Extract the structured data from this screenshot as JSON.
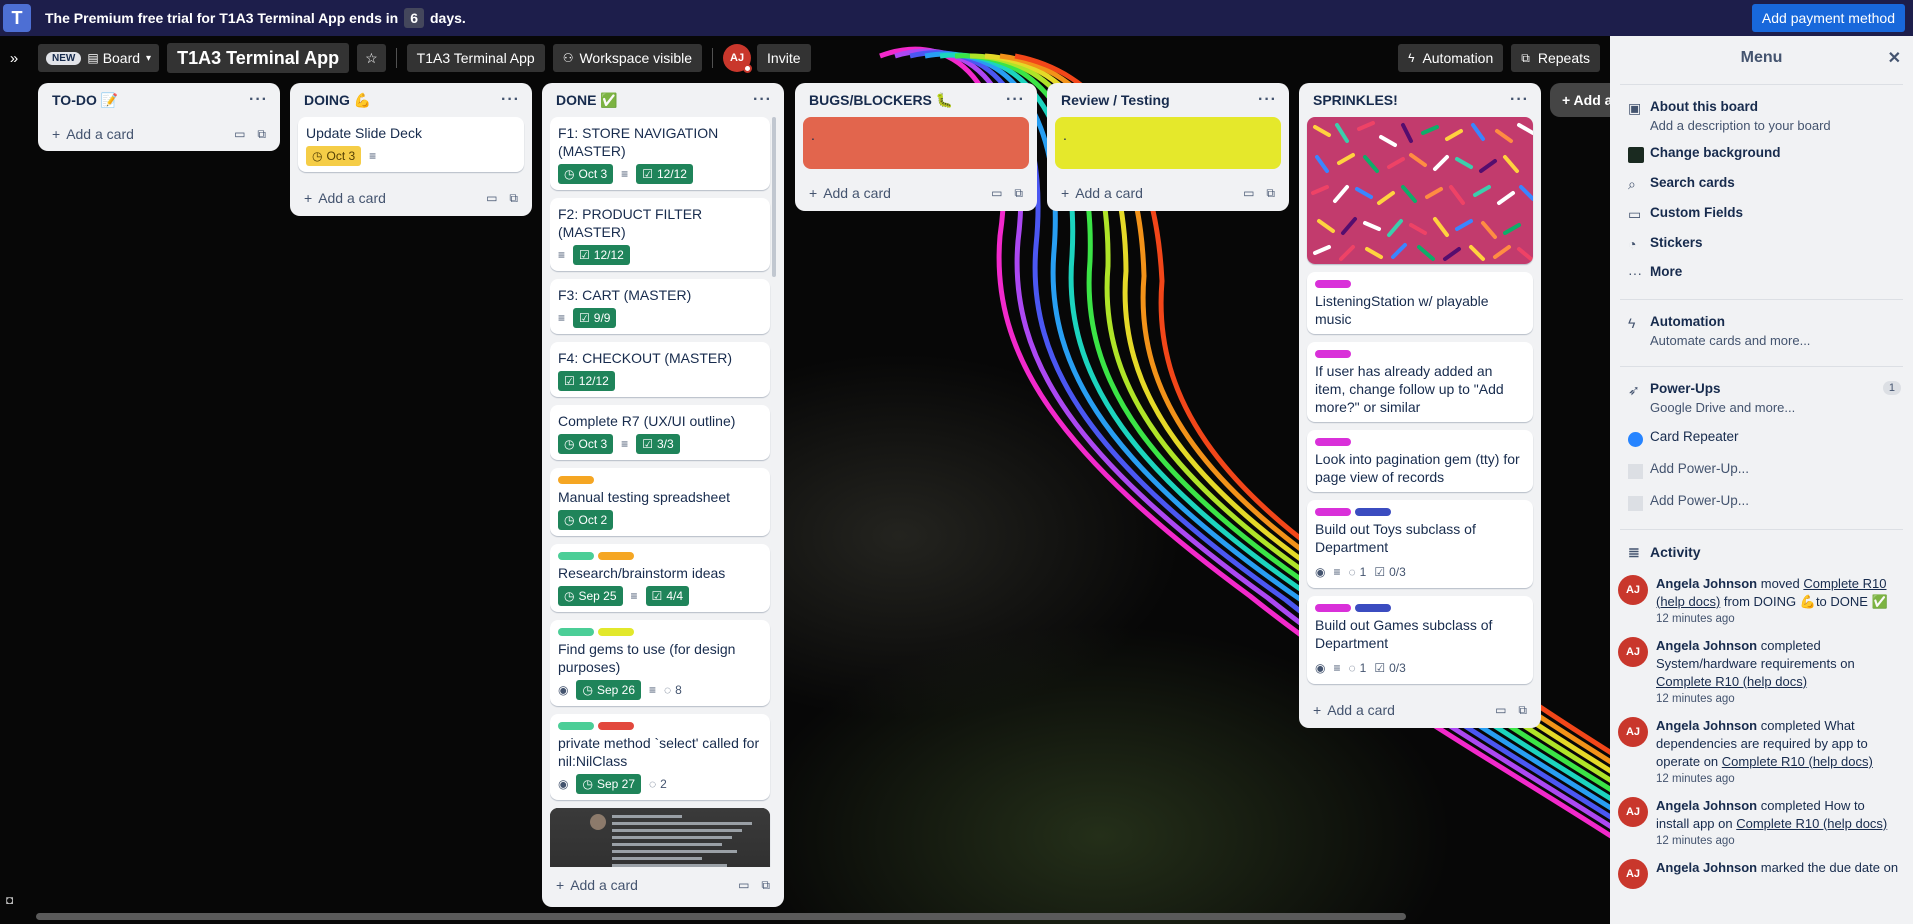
{
  "trial": {
    "text_before": "The Premium free trial for T1A3 Terminal App ends in",
    "days": "6",
    "text_after": "days.",
    "pay_button": "Add payment method"
  },
  "header": {
    "new_badge": "NEW",
    "board_view": "Board",
    "board_title": "T1A3 Terminal App",
    "workspace_name": "T1A3 Terminal App",
    "visibility": "Workspace visible",
    "avatar_initials": "AJ",
    "invite": "Invite",
    "automation": "Automation",
    "repeats": "Repeats"
  },
  "lists": {
    "todo": {
      "title": "TO-DO 📝",
      "add": "Add a card"
    },
    "doing": {
      "title": "DOING 💪",
      "add": "Add a card",
      "cards": [
        {
          "title": "Update Slide Deck",
          "due": "Oct 3"
        }
      ]
    },
    "done": {
      "title": "DONE ✅",
      "add": "Add a card",
      "cards": [
        {
          "title": "F1: STORE NAVIGATION (MASTER)",
          "due": "Oct 3",
          "check": "12/12"
        },
        {
          "title": "F2: PRODUCT FILTER (MASTER)",
          "check": "12/12"
        },
        {
          "title": "F3: CART (MASTER)",
          "check": "9/9"
        },
        {
          "title": "F4: CHECKOUT (MASTER)",
          "check": "12/12"
        },
        {
          "title": "Complete R7 (UX/UI outline)",
          "due": "Oct 3",
          "check": "3/3"
        },
        {
          "title": "Manual testing spreadsheet",
          "due": "Oct 2"
        },
        {
          "title": "Research/brainstorm ideas",
          "due": "Sep 25",
          "check": "4/4"
        },
        {
          "title": "Find gems to use (for design purposes)",
          "due": "Sep 26",
          "comments": "8"
        },
        {
          "title": "private method `select' called for nil:NilClass",
          "due": "Sep 27",
          "comments": "2"
        }
      ]
    },
    "bugs": {
      "title": "BUGS/BLOCKERS 🐛",
      "add": "Add a card",
      "card_text": ".",
      "card_color": "#e2654d"
    },
    "review": {
      "title": "Review / Testing",
      "add": "Add a card",
      "card_text": ".",
      "card_color": "#e5e82b"
    },
    "sprinkles": {
      "title": "SPRINKLES!",
      "add": "Add a card",
      "cover_caption": ".",
      "cards": [
        {
          "title": "ListeningStation w/ playable music"
        },
        {
          "title": "If user has already added an item, change follow up to \"Add more?\" or similar"
        },
        {
          "title": "Look into pagination gem (tty) for page view of records"
        },
        {
          "title": "Build out Toys subclass of Department",
          "comments": "1",
          "check": "0/3"
        },
        {
          "title": "Build out Games subclass of Department",
          "comments": "1",
          "check": "0/3"
        }
      ]
    },
    "add_list": "+ Add a"
  },
  "menu": {
    "title": "Menu",
    "about_title": "About this board",
    "about_sub": "Add a description to your board",
    "change_bg": "Change background",
    "search_cards": "Search cards",
    "custom_fields": "Custom Fields",
    "stickers": "Stickers",
    "more": "More",
    "automation_title": "Automation",
    "automation_sub": "Automate cards and more...",
    "powerups_title": "Power-Ups",
    "powerups_sub": "Google Drive and more...",
    "powerups_count": "1",
    "card_repeater": "Card Repeater",
    "add_powerup_1": "Add Power-Up...",
    "add_powerup_2": "Add Power-Up...",
    "activity_title": "Activity",
    "activities": [
      {
        "user": "Angela Johnson",
        "pre": " moved ",
        "link": "Complete R10 (help docs)",
        "post": " from DOING 💪to DONE ✅",
        "time": "12 minutes ago"
      },
      {
        "user": "Angela Johnson",
        "pre": " completed System/hardware requirements on ",
        "link": "Complete R10 (help docs)",
        "post": "",
        "time": "12 minutes ago"
      },
      {
        "user": "Angela Johnson",
        "pre": " completed What dependencies are required by app to operate on ",
        "link": "Complete R10 (help docs)",
        "post": "",
        "time": "12 minutes ago"
      },
      {
        "user": "Angela Johnson",
        "pre": " completed How to install app on ",
        "link": "Complete R10 (help docs)",
        "post": "",
        "time": "12 minutes ago"
      },
      {
        "user": "Angela Johnson",
        "pre": " marked the due date on",
        "link": "",
        "post": "",
        "time": ""
      }
    ]
  },
  "colors": {
    "trial_bg": "#1d1e4b",
    "pay_button": "#1868db",
    "due_green": "#1f845a",
    "due_yellow": "#f5cd47",
    "list_bg": "#f1f2f4",
    "avatar": "#c9372c"
  }
}
